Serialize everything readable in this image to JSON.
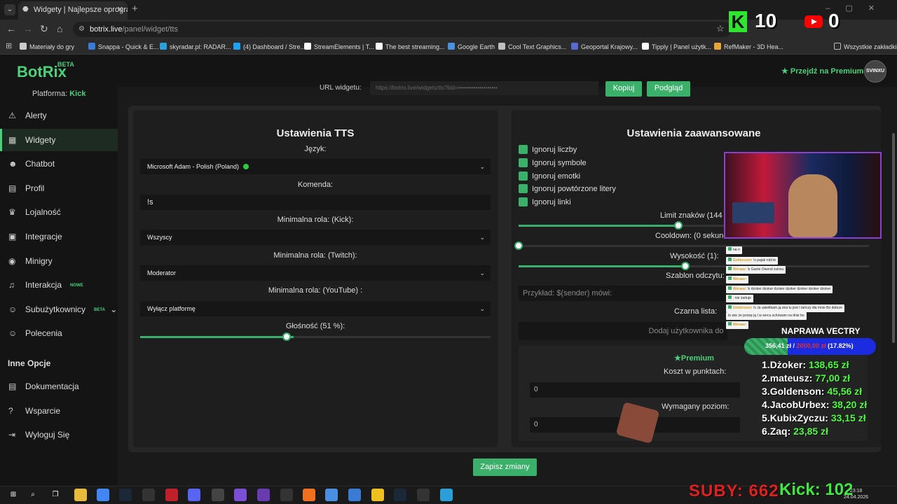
{
  "browser": {
    "tab_title": "Widgety | Najlepsze oprogramo",
    "url_host": "botrix.live",
    "url_path": "/panel/widget/tts",
    "bookmarks": [
      "Materiały do gry",
      "Snappa - Quick & E...",
      "skyradar.pl: RADAR...",
      "(4) Dashboard / Stre...",
      "StreamElements | T...",
      "The best streaming...",
      "Google Earth",
      "Cool Text Graphics...",
      "Geoportal Krajowy...",
      "Tipply | Panel użytk...",
      "RefMaker - 3D Hea..."
    ],
    "all_bookmarks": "Wszystkie zakładki"
  },
  "overlay_top": {
    "kick_count": "10",
    "youtube_count": "0",
    "kick_letter": "K"
  },
  "app": {
    "logo": "BotRix",
    "beta": "BETA",
    "premium_link": "Przejdź na Premium",
    "avatar_text": "SVINXU",
    "platform_label": "Platforma:",
    "platform_value": "Kick"
  },
  "sidebar": {
    "items": [
      {
        "label": "Alerty",
        "icon": "⚠"
      },
      {
        "label": "Widgety",
        "icon": "▦"
      },
      {
        "label": "Chatbot",
        "icon": "☻"
      },
      {
        "label": "Profil",
        "icon": "▤"
      },
      {
        "label": "Lojalność",
        "icon": "♛"
      },
      {
        "label": "Integracje",
        "icon": "▣"
      },
      {
        "label": "Minigry",
        "icon": "◉"
      },
      {
        "label": "Interakcja",
        "icon": "♫",
        "tag": "NOWE"
      },
      {
        "label": "Subużytkownicy",
        "icon": "☺",
        "tag": "BETA"
      },
      {
        "label": "Polecenia",
        "icon": "☺"
      }
    ],
    "section": "Inne Opcje",
    "other": [
      {
        "label": "Dokumentacja",
        "icon": "▤"
      },
      {
        "label": "Wsparcie",
        "icon": "?"
      },
      {
        "label": "Wyloguj Się",
        "icon": "⇥"
      }
    ]
  },
  "widget_url": {
    "label": "URL widgetu:",
    "copy": "Kopiuj",
    "preview": "Podgląd"
  },
  "tts": {
    "title": "Ustawienia TTS",
    "language_label": "Język:",
    "language_value": "Microsoft Adam - Polish (Poland)",
    "command_label": "Komenda:",
    "command_value": "!s",
    "kick_role_label": "Minimalna rola: (Kick):",
    "kick_role_value": "Wszyscy",
    "twitch_role_label": "Minimalna rola: (Twitch):",
    "twitch_role_value": "Moderator",
    "youtube_role_label": "Minimalna rola: (YouTube) :",
    "youtube_role_value": "Wyłącz platformę",
    "volume_label": "Głośność (51 %):",
    "volume": 0.51
  },
  "advanced": {
    "title": "Ustawienia zaawansowane",
    "checks": [
      "Ignoruj liczby",
      "Ignoruj symbole",
      "Ignoruj emotki",
      "Ignoruj powtórzone litery",
      "Ignoruj linki"
    ],
    "char_limit_label": "Limit znaków (144",
    "cooldown_label": "Cooldown: (0 sekund",
    "pitch_label": "Wysokość (1):",
    "template_label": "Szablon odczytu:",
    "template_placeholder": "Przykład: $(sender) mówi:",
    "blacklist_label": "Czarna lista:",
    "blacklist_placeholder": "Dodaj użytkownika do cz",
    "premium_badge": "Premium",
    "points_cost_label": "Koszt w punktach:",
    "points_cost_value": "0",
    "required_level_label": "Wymagany poziom:",
    "required_level_value": "0"
  },
  "save_button": "Zapisz zmiany",
  "chat": [
    {
      "user": "",
      "text": "na n"
    },
    {
      "user": "Goldenson",
      "text": ": !s pajak robi łe"
    },
    {
      "user": "Weraav",
      "text": ": !s Guete Owend svinxu"
    },
    {
      "user": "Weraav",
      "text": ":"
    },
    {
      "user": "Weraav",
      "text": ": !s dzoker dzoker dzoker dzoker dzoker dzoker dzoker"
    },
    {
      "user": "",
      "text": ": nie żartuje"
    },
    {
      "user": "Goldenson",
      "text": ": !s Ja uwielbiam ją ona tu jest I tańczy dla mnie Bo dobrze"
    },
    {
      "user": "",
      "text": "to wie że porwę ją I w sercu schowam na dnie bo"
    },
    {
      "user": "Weraav",
      "text": ":"
    }
  ],
  "goal": {
    "title": "NAPRAWA VECTRY",
    "current": "356,41 zł /",
    "target": "2000,00 zł",
    "percent": "(17.82%)",
    "fraction": 0.1782
  },
  "leaderboard": [
    {
      "rank": "1.",
      "name": "Dżoker:",
      "amount": "138,65 zł"
    },
    {
      "rank": "2.",
      "name": "mateusz:",
      "amount": "77,00 zł"
    },
    {
      "rank": "3.",
      "name": "Goldenson:",
      "amount": "45,56 zł"
    },
    {
      "rank": "4.",
      "name": "JacobUrbex:",
      "amount": "38,20 zł"
    },
    {
      "rank": "5.",
      "name": "KubixZyczu:",
      "amount": "33,15 zł"
    },
    {
      "rank": "6.",
      "name": "Zaq:",
      "amount": "23,85 zł"
    }
  ],
  "taskbar": {
    "subs": "SUBY: 662",
    "kick": "Kick: 102",
    "time": "23:18",
    "date": "24.04.2026"
  },
  "colors": {
    "accent": "#3bb06a",
    "kick": "#2ee62e",
    "goal_bar": "#1a2be0"
  }
}
